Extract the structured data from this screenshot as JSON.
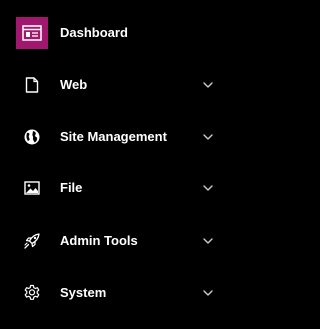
{
  "colors": {
    "background": "#000000",
    "text": "#ffffff",
    "active_icon_bg": "#a0186e"
  },
  "sidebar": {
    "items": [
      {
        "label": "Dashboard",
        "icon": "dashboard-icon",
        "active": true,
        "expandable": false
      },
      {
        "label": "Web",
        "icon": "document-icon",
        "active": false,
        "expandable": true
      },
      {
        "label": "Site Management",
        "icon": "globe-icon",
        "active": false,
        "expandable": true
      },
      {
        "label": "File",
        "icon": "image-icon",
        "active": false,
        "expandable": true
      },
      {
        "label": "Admin Tools",
        "icon": "rocket-icon",
        "active": false,
        "expandable": true
      },
      {
        "label": "System",
        "icon": "gear-icon",
        "active": false,
        "expandable": true
      }
    ]
  }
}
